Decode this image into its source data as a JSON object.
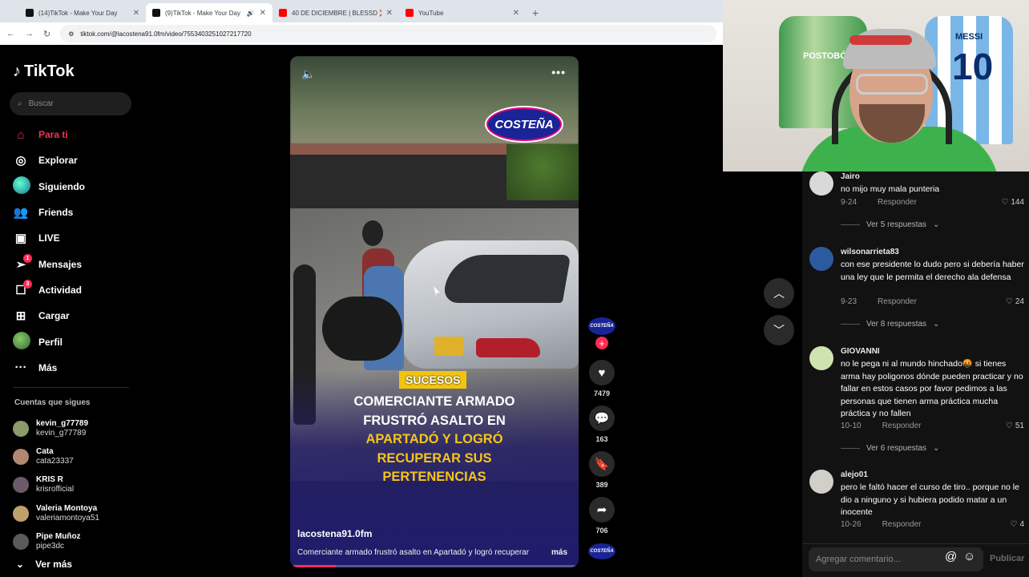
{
  "browser": {
    "tabs": [
      {
        "title": "(14)TikTok - Make Your Day",
        "icon": "tiktok-icon",
        "active": false
      },
      {
        "title": "(9)TikTok - Make Your Day",
        "icon": "tiktok-icon",
        "active": true
      },
      {
        "title": "40 DE DICIEMBRE | BLESSD ❌",
        "icon": "youtube-icon",
        "active": false
      },
      {
        "title": "YouTube",
        "icon": "youtube-icon",
        "active": false
      }
    ],
    "url": "tiktok.com/@lacostena91.0fm/video/7553403251027217720"
  },
  "sidebar": {
    "brand": "TikTok",
    "search_placeholder": "Buscar",
    "nav": [
      {
        "label": "Para ti",
        "icon": "home-icon",
        "active": true
      },
      {
        "label": "Explorar",
        "icon": "compass-icon"
      },
      {
        "label": "Siguiendo",
        "icon": "avatar-icon"
      },
      {
        "label": "Friends",
        "icon": "people-icon"
      },
      {
        "label": "LIVE",
        "icon": "live-icon"
      },
      {
        "label": "Mensajes",
        "icon": "send-icon",
        "badge": "1"
      },
      {
        "label": "Actividad",
        "icon": "inbox-icon",
        "badge": "3"
      },
      {
        "label": "Cargar",
        "icon": "upload-icon"
      },
      {
        "label": "Perfil",
        "icon": "profile-avatar-icon"
      },
      {
        "label": "Más",
        "icon": "more-icon"
      }
    ],
    "following_header": "Cuentas que sigues",
    "following": [
      {
        "name": "kevin_g77789",
        "handle": "kevin_g77789",
        "color": "#8a9a6a"
      },
      {
        "name": "Cata",
        "handle": "cata23337",
        "color": "#b08870"
      },
      {
        "name": "KRIS R",
        "handle": "krisrofficial",
        "color": "#6a5a6a"
      },
      {
        "name": "Valeria Montoya",
        "handle": "valeriamontoya51",
        "color": "#c0a06a"
      },
      {
        "name": "Pipe Muñoz",
        "handle": "pipe3dc",
        "color": "#5a5a5a"
      }
    ],
    "see_more": "Ver más"
  },
  "video": {
    "label_tag": "SUCESOS",
    "headline_white_1": "COMERCIANTE ARMADO",
    "headline_white_2": "FRUSTRÓ ASALTO EN",
    "headline_yellow_1": "APARTADÓ Y LOGRÓ",
    "headline_yellow_2": "RECUPERAR SUS",
    "headline_white_3": "PERTENENCIAS",
    "logo_text": "COSTEÑA",
    "username": "lacostena91.0fm",
    "description": "Comerciante armado frustró asalto en Apartadó y logró recuperar",
    "more": "más",
    "progress": 0.15
  },
  "actions": {
    "likes": "7479",
    "comments": "163",
    "saves": "389",
    "shares": "706"
  },
  "webcam": {
    "jersey_left_text": "POSTOBÓ",
    "jersey_right_name": "MESSI",
    "jersey_right_number": "10"
  },
  "comments": [
    {
      "user": "Jairo",
      "text": "no mijo muy mala punteria",
      "date": "9-24",
      "reply": "Responder",
      "likes": "144",
      "replies": "Ver 5 respuestas",
      "avatar": "#d9d9d9"
    },
    {
      "user": "wilsonarrieta83",
      "text": "con ese presidente lo dudo pero si debería haber una ley que le permita el derecho ala defensa",
      "date": "9-23",
      "reply": "Responder",
      "likes": "24",
      "replies": "Ver 8 respuestas",
      "avatar": "#2c5aa0"
    },
    {
      "user": "GIOVANNI",
      "text": "no le pega ni al mundo hinchado🤬 si tienes arma hay poligonos dónde pueden practicar y no fallar en estos casos por favor pedimos a las personas que tienen arma práctica mucha práctica y no fallen",
      "date": "10-10",
      "reply": "Responder",
      "likes": "51",
      "replies": "Ver 6 respuestas",
      "avatar": "#cfe3b0"
    },
    {
      "user": "alejo01",
      "text": "pero le faltó hacer el curso de tiro.. porque no le dio a ninguno y si hubiera podido matar a un inocente",
      "date": "10-26",
      "reply": "Responder",
      "likes": "4",
      "avatar": "#d0d0c8"
    }
  ],
  "comment_input": {
    "placeholder": "Agregar comentario...",
    "post": "Publicar"
  }
}
